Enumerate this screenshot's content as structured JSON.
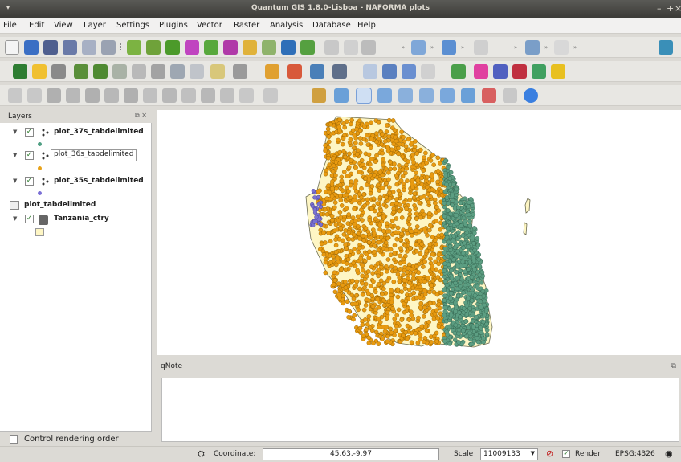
{
  "window": {
    "title": "Quantum GIS 1.8.0-Lisboa - NAFORMA plots"
  },
  "menu": {
    "items": [
      "File",
      "Edit",
      "View",
      "Layer",
      "Settings",
      "Plugins",
      "Vector",
      "Raster",
      "Analysis",
      "Database",
      "Help"
    ]
  },
  "layers_panel": {
    "title": "Layers",
    "layers": [
      {
        "name": "plot_37s_tabdelimited",
        "checked": true,
        "symbol_color": "#4f9f83"
      },
      {
        "name": "plot_36s_tabdelimited",
        "checked": true,
        "symbol_color": "#e8a21a",
        "editing": true
      },
      {
        "name": "plot_35s_tabdelimited",
        "checked": true,
        "symbol_color": "#7b6fd6"
      },
      {
        "name": "plot_tabdelimited",
        "checked": false,
        "table": true
      },
      {
        "name": "Tanzania_ctry",
        "checked": true,
        "symbol_color": "#fef6c4"
      }
    ],
    "render_order_label": "Control rendering order"
  },
  "qnote": {
    "title": "qNote"
  },
  "status": {
    "coordinate_label": "Coordinate:",
    "coordinate_value": "45.63,-9.97",
    "scale_label": "Scale",
    "scale_value": "11009133",
    "render_label": "Render",
    "render_checked": true,
    "crs": "EPSG:4326"
  },
  "colors": {
    "country_fill": "#fef6c4",
    "plots_west": "#e89a10",
    "plots_east": "#5c9e82",
    "plots_35s": "#7a72d2"
  }
}
